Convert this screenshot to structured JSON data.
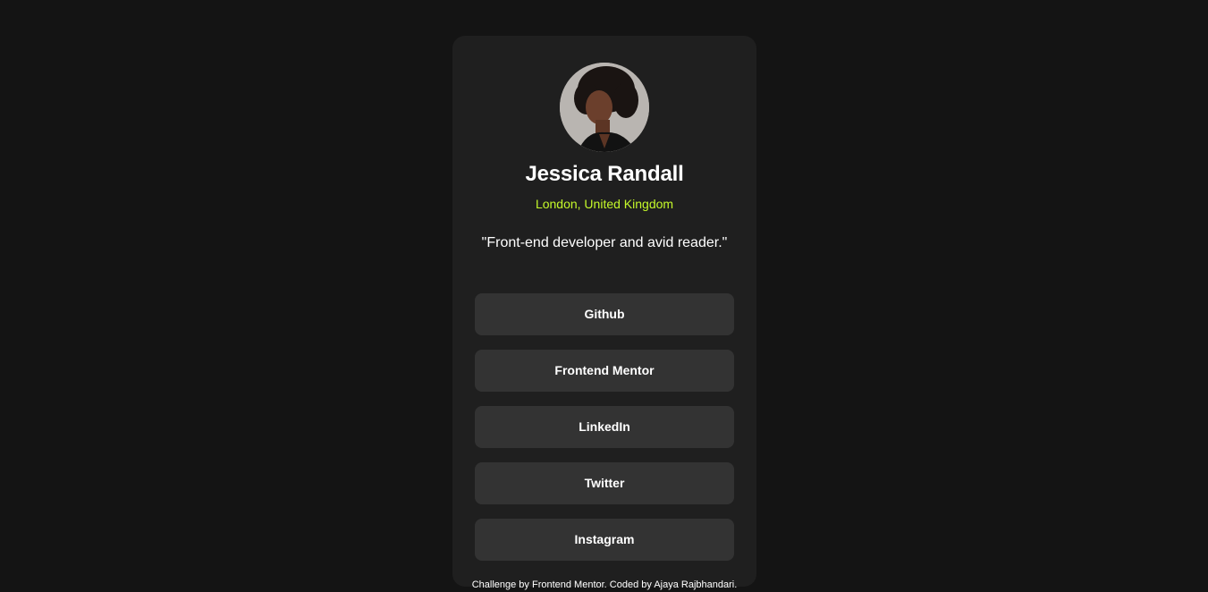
{
  "profile": {
    "name": "Jessica Randall",
    "location": "London, United Kingdom",
    "bio": "\"Front-end developer and avid reader.\"",
    "avatar_icon": "profile-photo"
  },
  "links": [
    {
      "label": "Github"
    },
    {
      "label": "Frontend Mentor"
    },
    {
      "label": "LinkedIn"
    },
    {
      "label": "Twitter"
    },
    {
      "label": "Instagram"
    }
  ],
  "attribution": "Challenge by Frontend Mentor. Coded by Ajaya Rajbhandari.",
  "colors": {
    "page_background": "#141414",
    "card_background": "#1f1f1f",
    "button_background": "#333333",
    "accent": "#c4f82a",
    "text": "#ffffff"
  }
}
